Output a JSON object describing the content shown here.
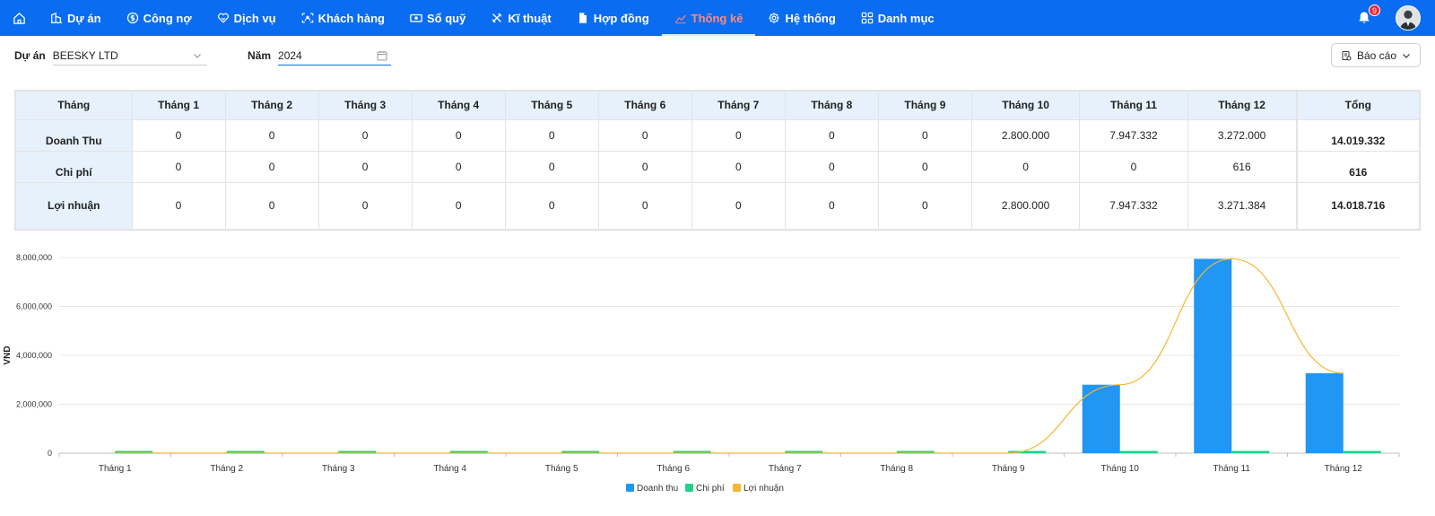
{
  "nav": {
    "items": [
      {
        "label": "Dự án",
        "icon": "building-icon",
        "active": false
      },
      {
        "label": "Công nợ",
        "icon": "dollar-circle-icon",
        "active": false
      },
      {
        "label": "Dịch vụ",
        "icon": "heart-handshake-icon",
        "active": false
      },
      {
        "label": "Khách hàng",
        "icon": "scan-user-icon",
        "active": false
      },
      {
        "label": "Sổ quỹ",
        "icon": "cash-icon",
        "active": false
      },
      {
        "label": "Kĩ thuật",
        "icon": "tools-icon",
        "active": false
      },
      {
        "label": "Hợp đồng",
        "icon": "document-icon",
        "active": false
      },
      {
        "label": "Thống kê",
        "icon": "line-chart-icon",
        "active": true
      },
      {
        "label": "Hệ thống",
        "icon": "gear-icon",
        "active": false
      },
      {
        "label": "Danh mục",
        "icon": "grid-icon",
        "active": false
      }
    ],
    "notification_count": "9"
  },
  "filters": {
    "project_label": "Dự án",
    "project_value": "BEESKY LTD",
    "year_label": "Năm",
    "year_value": "2024"
  },
  "report_button": "Báo cáo",
  "table": {
    "corner": "Tháng",
    "months": [
      "Tháng 1",
      "Tháng 2",
      "Tháng 3",
      "Tháng 4",
      "Tháng 5",
      "Tháng 6",
      "Tháng 7",
      "Tháng 8",
      "Tháng 9",
      "Tháng 10",
      "Tháng 11",
      "Tháng 12"
    ],
    "total_header": "Tổng",
    "rows": [
      {
        "label": "Doanh Thu",
        "values": [
          "0",
          "0",
          "0",
          "0",
          "0",
          "0",
          "0",
          "0",
          "0",
          "2.800.000",
          "7.947.332",
          "3.272.000"
        ],
        "total": "14.019.332"
      },
      {
        "label": "Chi phí",
        "values": [
          "0",
          "0",
          "0",
          "0",
          "0",
          "0",
          "0",
          "0",
          "0",
          "0",
          "0",
          "616"
        ],
        "total": "616"
      },
      {
        "label": "Lợi nhuận",
        "values": [
          "0",
          "0",
          "0",
          "0",
          "0",
          "0",
          "0",
          "0",
          "0",
          "2.800.000",
          "7.947.332",
          "3.271.384"
        ],
        "total": "14.018.716"
      }
    ]
  },
  "chart_data": {
    "type": "bar",
    "ylabel": "VND",
    "ylim": [
      0,
      8000000
    ],
    "yticks": [
      "0",
      "2,000,000",
      "4,000,000",
      "6,000,000",
      "8,000,000"
    ],
    "ytick_values": [
      0,
      2000000,
      4000000,
      6000000,
      8000000
    ],
    "categories": [
      "Tháng 1",
      "Tháng 2",
      "Tháng 3",
      "Tháng 4",
      "Tháng 5",
      "Tháng 6",
      "Tháng 7",
      "Tháng 8",
      "Tháng 9",
      "Tháng 10",
      "Tháng 11",
      "Tháng 12"
    ],
    "grid": true,
    "legend_position": "bottom",
    "series": [
      {
        "name": "Doanh thu",
        "kind": "bar",
        "color": "#2196f3",
        "values": [
          0,
          0,
          0,
          0,
          0,
          0,
          0,
          0,
          0,
          2800000,
          7947332,
          3272000
        ]
      },
      {
        "name": "Chi phí",
        "kind": "bar",
        "color": "#1fd28a",
        "values": [
          0,
          0,
          0,
          0,
          0,
          0,
          0,
          0,
          0,
          0,
          0,
          616
        ]
      },
      {
        "name": "Lợi nhuận",
        "kind": "line",
        "color": "#f5b82e",
        "values": [
          0,
          0,
          0,
          0,
          0,
          0,
          0,
          0,
          0,
          2800000,
          7947332,
          3271384
        ]
      }
    ]
  }
}
